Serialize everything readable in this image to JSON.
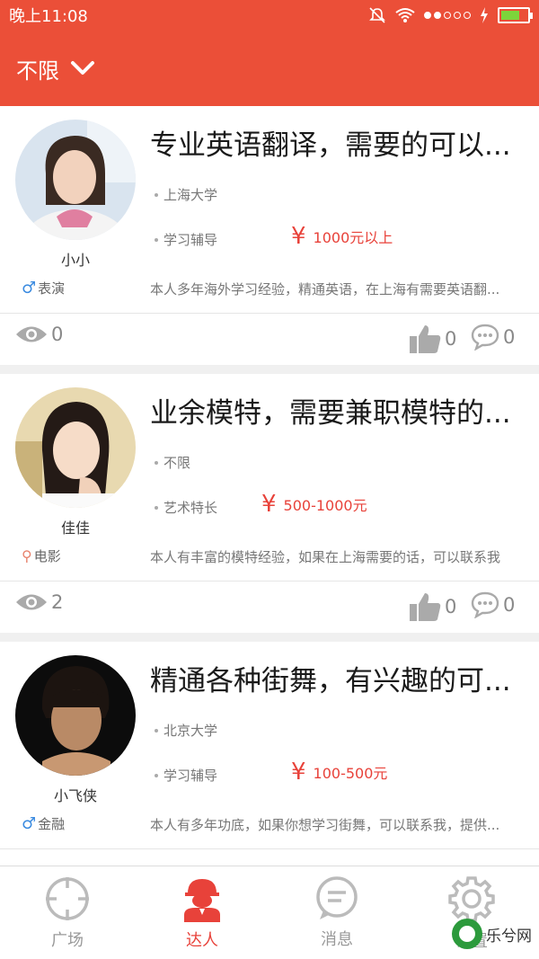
{
  "status_bar": {
    "time": "晚上11:08"
  },
  "header": {
    "filter_label": "不限"
  },
  "cards": [
    {
      "title": "专业英语翻译，需要的可以...",
      "name": "小小",
      "tag": "表演",
      "school": "上海大学",
      "category": "学习辅导",
      "price_symbol": "¥",
      "price": "1000元以上",
      "desc": "本人多年海外学习经验，精通英语，在上海有需要英语翻...",
      "views": "0",
      "likes": "0",
      "comments": "0"
    },
    {
      "title": "业余模特，需要兼职模特的...",
      "name": "佳佳",
      "tag": "电影",
      "school": "不限",
      "category": "艺术特长",
      "price_symbol": "¥",
      "price": "500-1000元",
      "desc": "本人有丰富的模特经验，如果在上海需要的话，可以联系我",
      "views": "2",
      "likes": "0",
      "comments": "0"
    },
    {
      "title": "精通各种街舞，有兴趣的可...",
      "name": "小飞侠",
      "tag": "金融",
      "school": "北京大学",
      "category": "学习辅导",
      "price_symbol": "¥",
      "price": "100-500元",
      "desc": "本人有多年功底，如果你想学习街舞，可以联系我，提供...",
      "views": "",
      "likes": "",
      "comments": ""
    }
  ],
  "bottom_nav": {
    "items": [
      {
        "label": "广场",
        "icon": "crosshair-icon",
        "active": false
      },
      {
        "label": "达人",
        "icon": "worker-icon",
        "active": true
      },
      {
        "label": "消息",
        "icon": "chat-icon",
        "active": false
      },
      {
        "label": "设置",
        "icon": "gear-icon",
        "active": false
      }
    ]
  },
  "watermark": {
    "text": "乐兮网"
  },
  "colors": {
    "brand": "#eb4f38",
    "price": "#e8423a",
    "gender_male": "#3b8be0"
  }
}
